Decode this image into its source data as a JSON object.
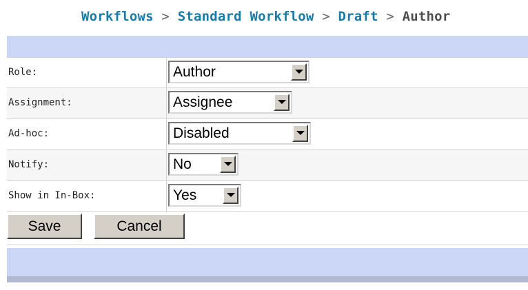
{
  "breadcrumb": {
    "items": [
      "Workflows",
      "Standard Workflow",
      "Draft"
    ],
    "current": "Author",
    "separator": ">"
  },
  "fields": [
    {
      "label": "Role:",
      "value": "Author"
    },
    {
      "label": "Assignment:",
      "value": "Assignee"
    },
    {
      "label": "Ad-hoc:",
      "value": "Disabled"
    },
    {
      "label": "Notify:",
      "value": "No"
    },
    {
      "label": "Show in In-Box:",
      "value": "Yes"
    }
  ],
  "buttons": {
    "save": "Save",
    "cancel": "Cancel"
  },
  "colors": {
    "link": "#1a7aa8",
    "band": "#ccd6f7",
    "row_alt": "#f6f6f6",
    "button_face": "#d4d0c8"
  }
}
